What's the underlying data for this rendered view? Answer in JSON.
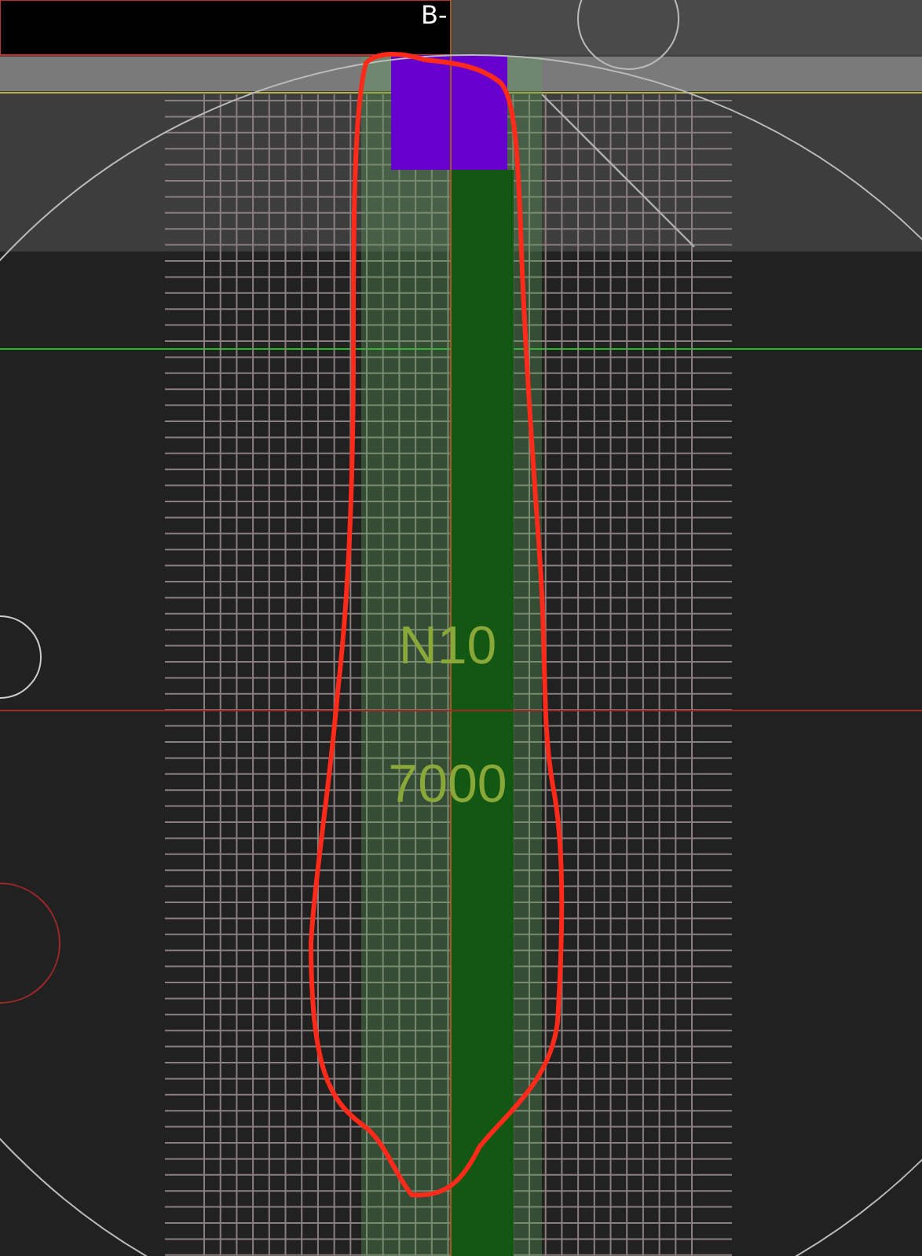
{
  "drawing": {
    "corner_label": "B-",
    "bar_mark": "N10",
    "length": "7000"
  }
}
